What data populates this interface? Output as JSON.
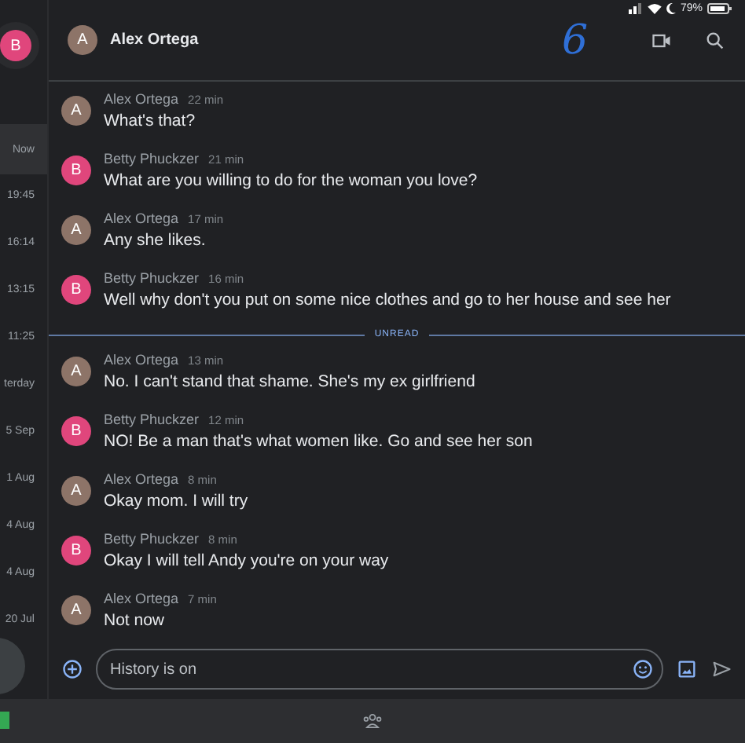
{
  "status_bar": {
    "battery": "79%"
  },
  "sidebar": {
    "avatar": "B",
    "items": [
      {
        "label": "Now",
        "selected": true
      },
      {
        "label": "19:45",
        "selected": false
      },
      {
        "label": "16:14",
        "selected": false
      },
      {
        "label": "13:15",
        "selected": false
      },
      {
        "label": "11:25",
        "selected": false
      },
      {
        "label": "terday",
        "selected": false
      },
      {
        "label": "5 Sep",
        "selected": false
      },
      {
        "label": "1 Aug",
        "selected": false
      },
      {
        "label": "4 Aug",
        "selected": false
      },
      {
        "label": "4 Aug",
        "selected": false
      },
      {
        "label": "20 Jul",
        "selected": false
      }
    ]
  },
  "header": {
    "avatar": "A",
    "title": "Alex Ortega",
    "annotation": "6"
  },
  "messages": [
    {
      "kind": "message",
      "avatar": "A",
      "color": "#8d7468",
      "name": "Alex Ortega",
      "time": "22 min",
      "text": "What's that?"
    },
    {
      "kind": "message",
      "avatar": "B",
      "color": "#e0467c",
      "name": "Betty Phuckzer",
      "time": "21 min",
      "text": "What are you willing to do for the woman you love?"
    },
    {
      "kind": "message",
      "avatar": "A",
      "color": "#8d7468",
      "name": "Alex Ortega",
      "time": "17 min",
      "text": "Any she likes."
    },
    {
      "kind": "message",
      "avatar": "B",
      "color": "#e0467c",
      "name": "Betty Phuckzer",
      "time": "16 min",
      "text": "Well why don't you put on some nice clothes and go to her house and see her"
    },
    {
      "kind": "divider",
      "text": "UNREAD"
    },
    {
      "kind": "message",
      "avatar": "A",
      "color": "#8d7468",
      "name": "Alex Ortega",
      "time": "13 min",
      "text": "No. I can't stand that shame. She's my ex girlfriend"
    },
    {
      "kind": "message",
      "avatar": "B",
      "color": "#e0467c",
      "name": "Betty Phuckzer",
      "time": "12 min",
      "text": "NO! Be a man that's what women like. Go and see her son"
    },
    {
      "kind": "message",
      "avatar": "A",
      "color": "#8d7468",
      "name": "Alex Ortega",
      "time": "8 min",
      "text": "Okay mom. I will try"
    },
    {
      "kind": "message",
      "avatar": "B",
      "color": "#e0467c",
      "name": "Betty Phuckzer",
      "time": "8 min",
      "text": "Okay I will tell Andy you're on your way"
    },
    {
      "kind": "message",
      "avatar": "A",
      "color": "#8d7468",
      "name": "Alex Ortega",
      "time": "7 min",
      "text": "Not now"
    }
  ],
  "composer": {
    "placeholder": "History is on"
  }
}
